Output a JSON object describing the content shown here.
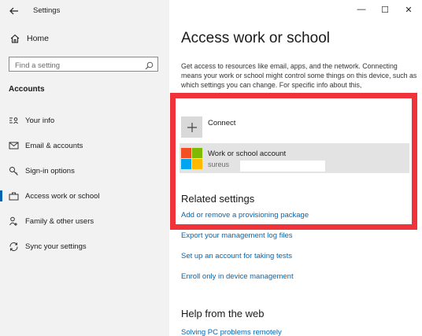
{
  "window": {
    "title": "Settings",
    "back_icon": "back-arrow-icon",
    "minimize_glyph": "—",
    "maximize_glyph": "☐",
    "close_glyph": "✕"
  },
  "sidebar": {
    "home_label": "Home",
    "search_placeholder": "Find a setting",
    "section_label": "Accounts",
    "items": [
      {
        "label": "Your info",
        "icon": "contact-card-icon",
        "active": false
      },
      {
        "label": "Email & accounts",
        "icon": "mail-icon",
        "active": false
      },
      {
        "label": "Sign-in options",
        "icon": "key-icon",
        "active": false
      },
      {
        "label": "Access work or school",
        "icon": "briefcase-icon",
        "active": true
      },
      {
        "label": "Family & other users",
        "icon": "people-icon",
        "active": false
      },
      {
        "label": "Sync your settings",
        "icon": "sync-icon",
        "active": false
      }
    ]
  },
  "main": {
    "title": "Access work or school",
    "description": "Get access to resources like email, apps, and the network. Connecting means your work or school might control some things on this device, such as which settings you can change. For specific info about this,",
    "connect_label": "Connect",
    "account": {
      "name": "Work or school account",
      "email_partial": "sureus"
    },
    "related_heading": "Related settings",
    "related_links": [
      "Add or remove a provisioning package",
      "Export your management log files",
      "Set up an account for taking tests",
      "Enroll only in device management"
    ],
    "help_heading": "Help from the web",
    "help_links": [
      "Solving PC problems remotely"
    ]
  },
  "colors": {
    "accent": "#0063b1",
    "link": "#0067b8",
    "highlight_box": "#f0333b",
    "sidebar_bg": "#f2f2f2",
    "selected_row_bg": "#e3e3e3"
  }
}
